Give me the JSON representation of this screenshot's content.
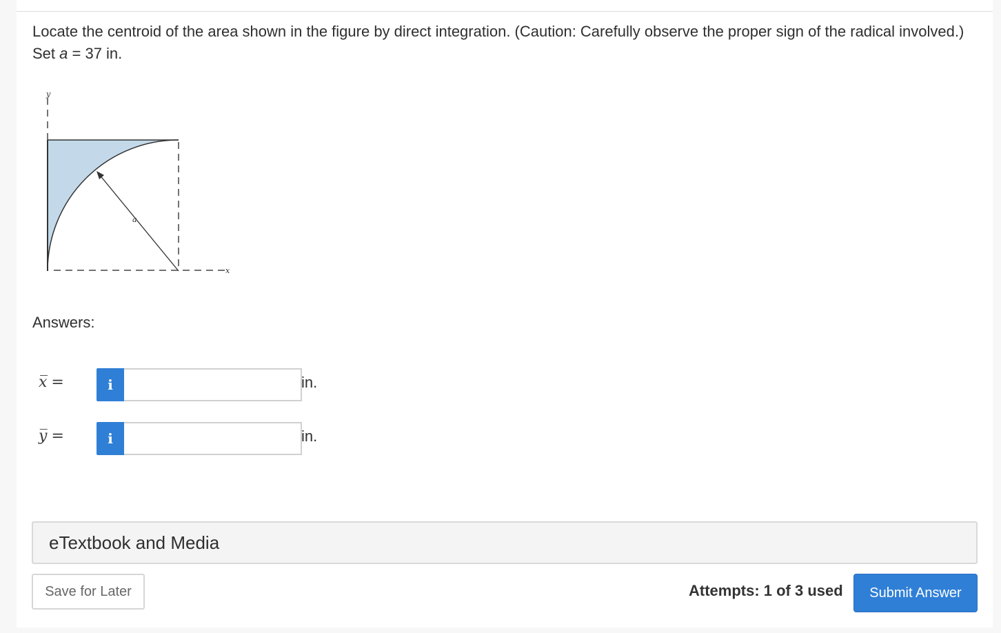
{
  "question": {
    "prefix": "Locate the centroid of the area shown in the figure by direct integration. (Caution: Carefully observe the proper sign of the radical involved.) Set ",
    "variable": "a",
    "suffix": " = 37 in."
  },
  "figure": {
    "fill_color": "#c3d9ea",
    "axis_label_x": "x",
    "axis_label_y": "y",
    "radius_label": "a"
  },
  "answers": {
    "label": "Answers:",
    "rows": [
      {
        "symbol": "x̅",
        "equals": "=",
        "info_icon": "i",
        "value": "",
        "unit": "in."
      },
      {
        "symbol": "y̅",
        "equals": "=",
        "info_icon": "i",
        "value": "",
        "unit": "in."
      }
    ]
  },
  "etextbook": {
    "label": "eTextbook and Media"
  },
  "footer": {
    "save_label": "Save for Later",
    "attempts_text": "Attempts: 1 of 3 used",
    "submit_label": "Submit Answer"
  },
  "colors": {
    "accent": "#2f7fd6"
  }
}
